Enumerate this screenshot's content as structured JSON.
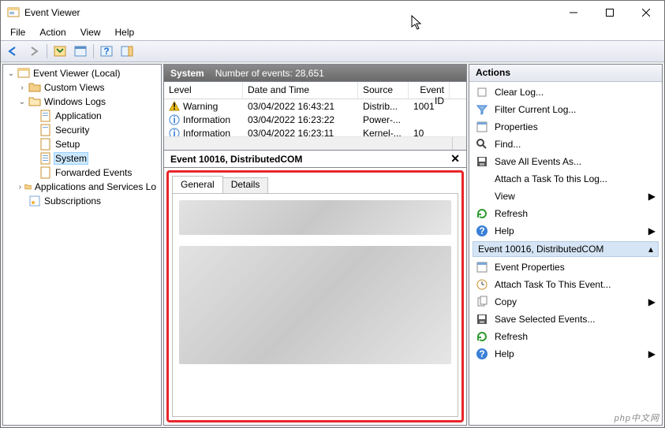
{
  "window": {
    "title": "Event Viewer"
  },
  "menus": [
    "File",
    "Action",
    "View",
    "Help"
  ],
  "tree": {
    "root": "Event Viewer (Local)",
    "nodes": [
      {
        "label": "Custom Views",
        "expand": "›"
      },
      {
        "label": "Windows Logs",
        "expand": "⌄",
        "children": [
          {
            "label": "Application"
          },
          {
            "label": "Security"
          },
          {
            "label": "Setup"
          },
          {
            "label": "System",
            "selected": true
          },
          {
            "label": "Forwarded Events"
          }
        ]
      },
      {
        "label": "Applications and Services Lo",
        "expand": "›"
      },
      {
        "label": "Subscriptions"
      }
    ]
  },
  "center": {
    "section": "System",
    "count_label": "Number of events: 28,651",
    "columns": [
      "Level",
      "Date and Time",
      "Source",
      "Event ID"
    ],
    "rows": [
      {
        "level": "Warning",
        "icon": "warn",
        "dt": "03/04/2022 16:43:21",
        "src": "Distrib...",
        "eid": "1001"
      },
      {
        "level": "Information",
        "icon": "info",
        "dt": "03/04/2022 16:23:22",
        "src": "Power-...",
        "eid": ""
      },
      {
        "level": "Information",
        "icon": "info",
        "dt": "03/04/2022 16:23:11",
        "src": "Kernel-...",
        "eid": "10"
      }
    ],
    "detail_header": "Event 10016, DistributedCOM",
    "tabs": {
      "general": "General",
      "details": "Details"
    }
  },
  "actions": {
    "title": "Actions",
    "group1_extra": "",
    "items1": [
      {
        "icon": "clear",
        "label": "Clear Log..."
      },
      {
        "icon": "filter",
        "label": "Filter Current Log..."
      },
      {
        "icon": "props",
        "label": "Properties"
      },
      {
        "icon": "find",
        "label": "Find..."
      },
      {
        "icon": "save",
        "label": "Save All Events As..."
      },
      {
        "icon": "",
        "label": "Attach a Task To this Log..."
      },
      {
        "icon": "",
        "label": "View",
        "submenu": true
      },
      {
        "icon": "refresh",
        "label": "Refresh"
      },
      {
        "icon": "help",
        "label": "Help",
        "submenu": true
      }
    ],
    "group2": "Event 10016, DistributedCOM",
    "items2": [
      {
        "icon": "props",
        "label": "Event Properties"
      },
      {
        "icon": "task",
        "label": "Attach Task To This Event..."
      },
      {
        "icon": "copy",
        "label": "Copy",
        "submenu": true
      },
      {
        "icon": "save",
        "label": "Save Selected Events..."
      },
      {
        "icon": "refresh",
        "label": "Refresh"
      },
      {
        "icon": "help",
        "label": "Help",
        "submenu": true
      }
    ]
  },
  "watermark": "php中文网"
}
